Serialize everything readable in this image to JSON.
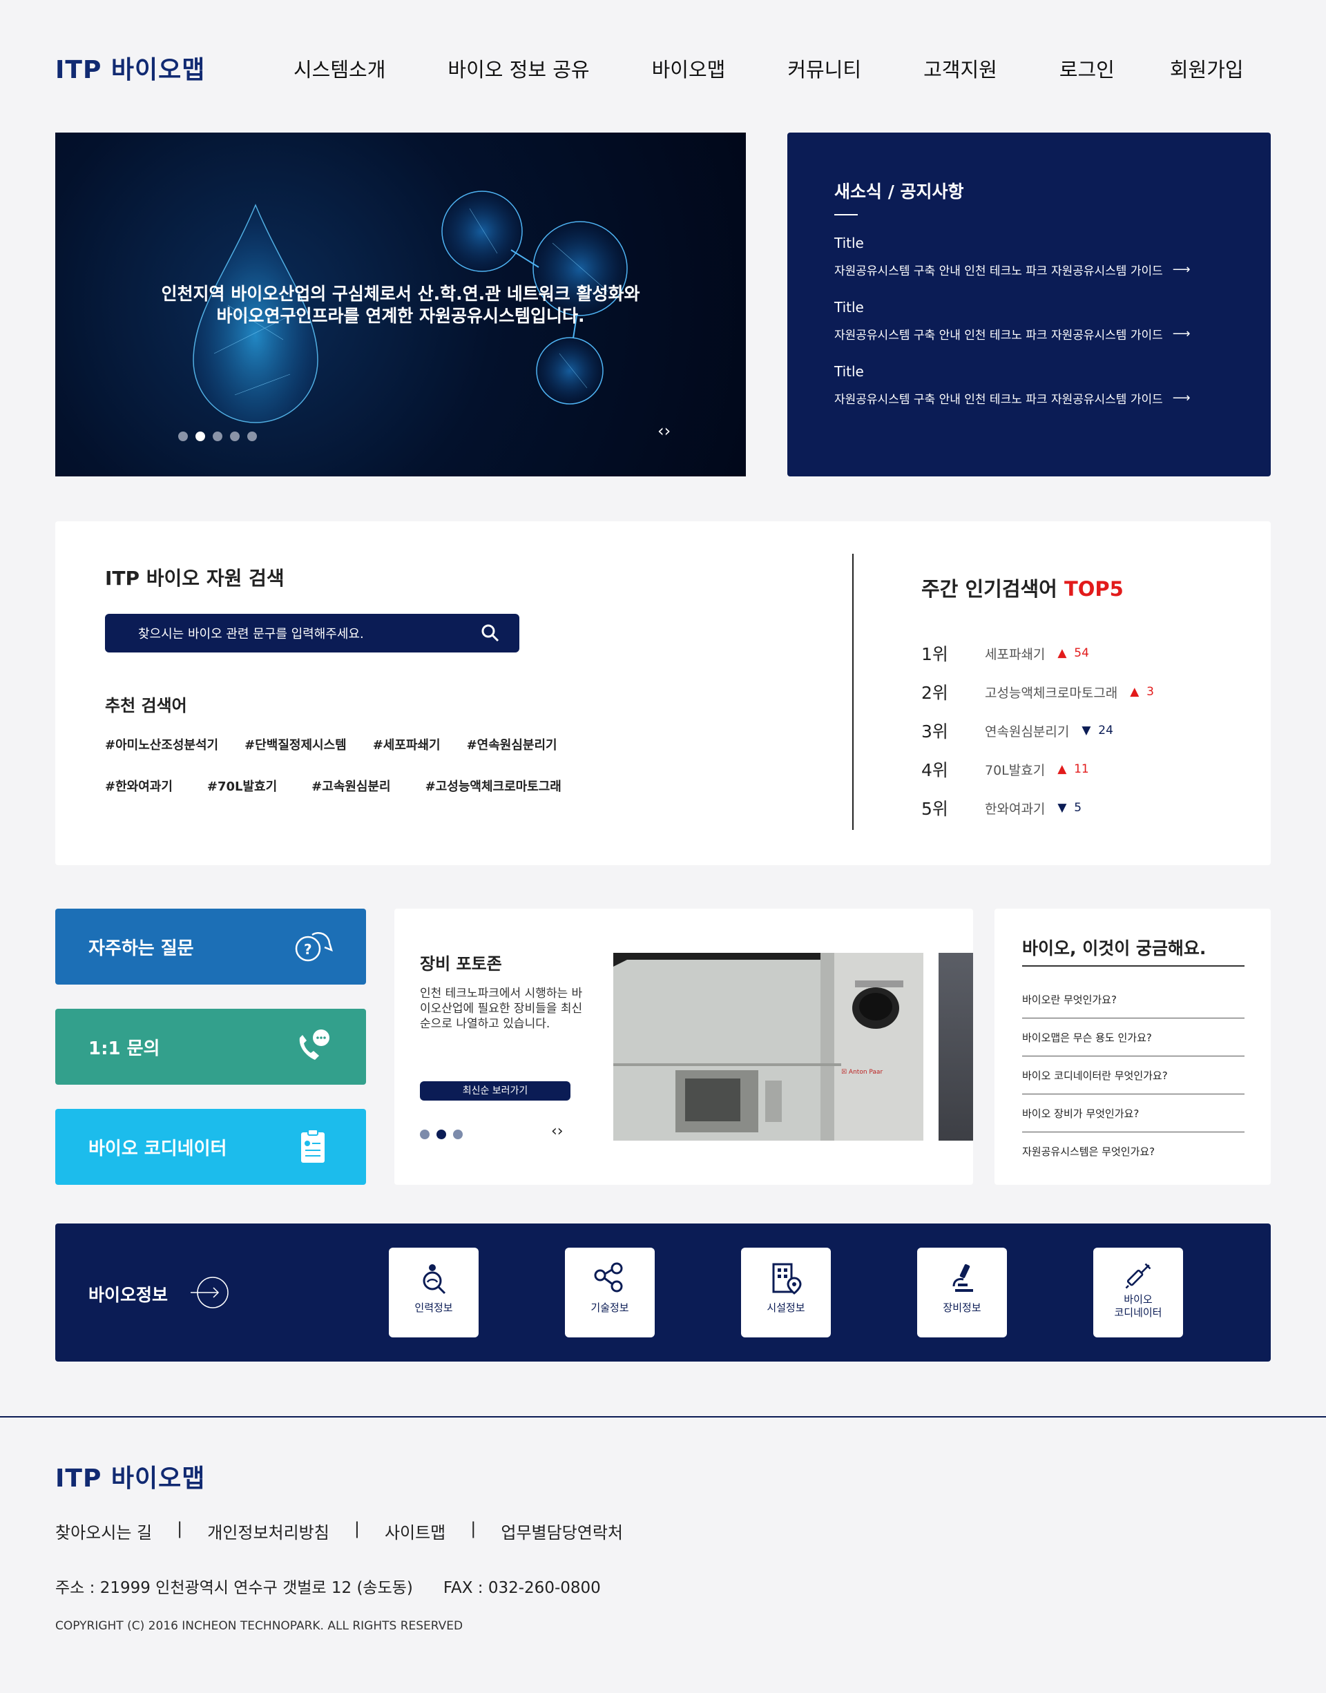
{
  "header": {
    "logo": "ITP 바이오맵",
    "nav": [
      "시스템소개",
      "바이오 정보 공유",
      "바이오맵",
      "커뮤니티",
      "고객지원",
      "로그인",
      "회원가입"
    ]
  },
  "hero": {
    "line1": "인천지역 바이오산업의 구심체로서 산.학.연.관 네트워크 활성화와",
    "line2": "바이오연구인프라를 연계한 자원공유시스템입니다.",
    "arrows": "‹›"
  },
  "news": {
    "title": "새소식 / 공지사항",
    "items": [
      {
        "title": "Title",
        "desc": "자원공유시스템 구축 안내 인천 테크노 파크 자원공유시스템 가이드"
      },
      {
        "title": "Title",
        "desc": "자원공유시스템 구축 안내 인천 테크노 파크 자원공유시스템 가이드"
      },
      {
        "title": "Title",
        "desc": "자원공유시스템 구축 안내 인천 테크노 파크 자원공유시스템 가이드"
      }
    ]
  },
  "search": {
    "title": "ITP 바이오 자원 검색",
    "placeholder": "찾으시는 바이오 관련 문구를 입력해주세요.",
    "rec_title": "추천 검색어",
    "tags_row1": [
      "#아미노산조성분석기",
      "#단백질정제시스템",
      "#세포파쇄기",
      "#연속원심분리기"
    ],
    "tags_row2": [
      "#한와여과기",
      "#70L발효기",
      "#고속원심분리",
      "#고성능액체크로마토그래"
    ]
  },
  "top5": {
    "title": "주간 인기검색어",
    "accent": "TOP5",
    "ranks": [
      {
        "rank": "1위",
        "word": "세포파쇄기",
        "dir": "▲",
        "change": "54",
        "up": true
      },
      {
        "rank": "2위",
        "word": "고성능액체크로마토그래",
        "dir": "▲",
        "change": "3",
        "up": true
      },
      {
        "rank": "3위",
        "word": "연속원심분리기",
        "dir": "▼",
        "change": "24",
        "up": false
      },
      {
        "rank": "4위",
        "word": "70L발효기",
        "dir": "▲",
        "change": "11",
        "up": true
      },
      {
        "rank": "5위",
        "word": "한와여과기",
        "dir": "▼",
        "change": "5",
        "up": false
      }
    ]
  },
  "quick": {
    "faq": "자주하는 질문",
    "qna": "1:1 문의",
    "coordinator": "바이오 코디네이터"
  },
  "equipment": {
    "title": "장비 포토존",
    "desc": "인천 테크노파크에서 시행하는 바이오산업에 필요한 장비들을 최신순으로 나열하고 있습니다.",
    "button": "최신순 보러가기",
    "arrows": "‹›"
  },
  "bioq": {
    "title": "바이오, 이것이 궁금해요.",
    "items": [
      "바이오란 무엇인가요?",
      "바이오맵은 무슨 용도 인가요?",
      "바이오 코디네이터란 무엇인가요?",
      "바이오 장비가 무엇인가요?",
      "자원공유시스템은 무엇인가요?"
    ]
  },
  "bioinfo": {
    "label": "바이오정보",
    "tiles": [
      "인력정보",
      "기술정보",
      "시설정보",
      "장비정보",
      "바이오\n코디네이터"
    ]
  },
  "footer": {
    "logo": "ITP 바이오맵",
    "links": [
      "찾아오시는 길",
      "개인정보처리방침",
      "사이트맵",
      "업무별담당연락처"
    ],
    "address": "주소 : 21999 인천광역시 연수구 갯벌로 12 (송도동)",
    "fax": "FAX : 032-260-0800",
    "copyright": "COPYRIGHT (C) 2016 INCHEON TECHNOPARK. ALL RIGHTS RESERVED"
  },
  "colors": {
    "navy": "#0b1c55",
    "faq": "#1c6fb6",
    "qna": "#33a08c",
    "coordinator": "#1cbcec",
    "accent_red": "#e21b1b"
  }
}
